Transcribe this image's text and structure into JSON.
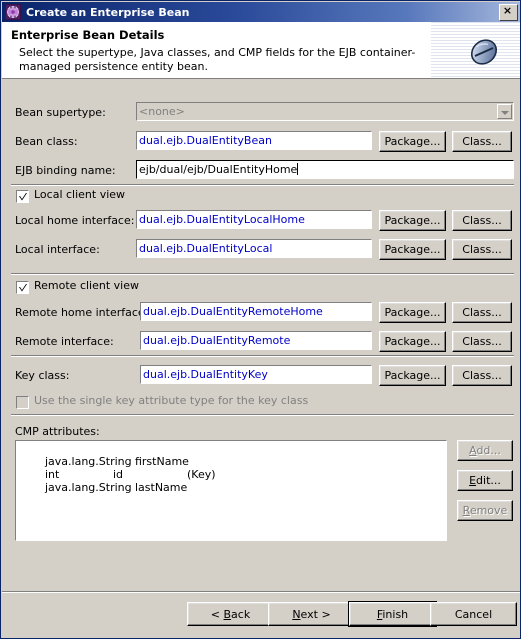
{
  "window": {
    "title": "Create an Enterprise Bean",
    "icon": "bean-wizard-icon",
    "close_label": "×"
  },
  "banner": {
    "title": "Enterprise Bean Details",
    "description": "Select the supertype, Java classes, and CMP fields for the EJB container-managed persistence entity bean.",
    "icon": "enterprise-bean-icon"
  },
  "form": {
    "bean_supertype": {
      "label": "Bean supertype:",
      "value": "<none>",
      "enabled": false
    },
    "bean_class": {
      "label": "Bean class:",
      "value": "dual.ejb.DualEntityBean"
    },
    "ejb_binding_name": {
      "label": "EJB binding name:",
      "value": "ejb/dual/ejb/DualEntityHome"
    },
    "local_client_view": {
      "label": "Local client view",
      "checked": true
    },
    "local_home_interface": {
      "label": "Local home interface:",
      "value": "dual.ejb.DualEntityLocalHome"
    },
    "local_interface": {
      "label": "Local interface:",
      "value": "dual.ejb.DualEntityLocal"
    },
    "remote_client_view": {
      "label": "Remote client view",
      "checked": true
    },
    "remote_home_interface": {
      "label": "Remote home interface:",
      "value": "dual.ejb.DualEntityRemoteHome"
    },
    "remote_interface": {
      "label": "Remote interface:",
      "value": "dual.ejb.DualEntityRemote"
    },
    "key_class": {
      "label": "Key class:",
      "value": "dual.ejb.DualEntityKey"
    },
    "single_key_attribute": {
      "label": "Use the single key attribute type for the key class",
      "checked": false,
      "enabled": false
    },
    "cmp_attributes": {
      "label": "CMP attributes:",
      "rows": [
        {
          "type": "java.lang.String",
          "name": "firstName",
          "key": ""
        },
        {
          "type": "int",
          "name": "id",
          "key": "(Key)"
        },
        {
          "type": "java.lang.String",
          "name": "lastName",
          "key": ""
        }
      ]
    }
  },
  "buttons": {
    "package": "Package...",
    "class": "Class...",
    "add": "Add...",
    "add_mnemonic": "A",
    "edit": "Edit...",
    "edit_mnemonic": "E",
    "remove": "Remove",
    "remove_mnemonic": "R",
    "back": "< Back",
    "back_mnemonic": "B",
    "next": "Next >",
    "next_mnemonic": "N",
    "finish": "Finish",
    "finish_mnemonic": "F",
    "cancel": "Cancel"
  },
  "colors": {
    "dialog_face": "#d4d0c8",
    "title_gradient_start": "#0a246a",
    "title_gradient_end": "#a6b8dc",
    "field_value_text": "#0000c8",
    "disabled_text": "#808080",
    "banner_background": "#ffffff"
  }
}
